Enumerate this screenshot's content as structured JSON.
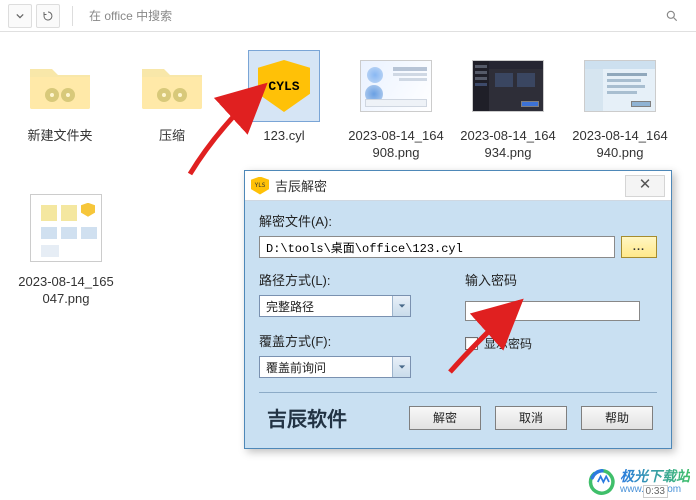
{
  "toolbar": {
    "search_placeholder": "在 office 中搜索"
  },
  "files": [
    {
      "name": "新建文件夹"
    },
    {
      "name": "压缩"
    },
    {
      "name": "123.cyl"
    },
    {
      "name": "2023-08-14_164908.png"
    },
    {
      "name": "2023-08-14_164934.png"
    },
    {
      "name": "2023-08-14_164940.png"
    },
    {
      "name": "2023-08-14_165047.png"
    }
  ],
  "cyl_badge_text": "CYLS",
  "dialog": {
    "title": "吉辰解密",
    "close": "✕",
    "decrypt_file_label": "解密文件(A):",
    "path_value": "D:\\tools\\桌面\\office\\123.cyl",
    "browse_label": "...",
    "path_mode_label": "路径方式(L):",
    "path_mode_value": "完整路径",
    "overwrite_label": "覆盖方式(F):",
    "overwrite_value": "覆盖前询问",
    "password_label": "输入密码",
    "show_password_label": "显示密码",
    "brand": "吉辰软件",
    "btn_decrypt": "解密",
    "btn_cancel": "取消",
    "btn_help": "帮助"
  },
  "watermark": {
    "name": "极光下载站",
    "url": "www.xz7.com"
  },
  "timestamp_overlay": "0:33"
}
